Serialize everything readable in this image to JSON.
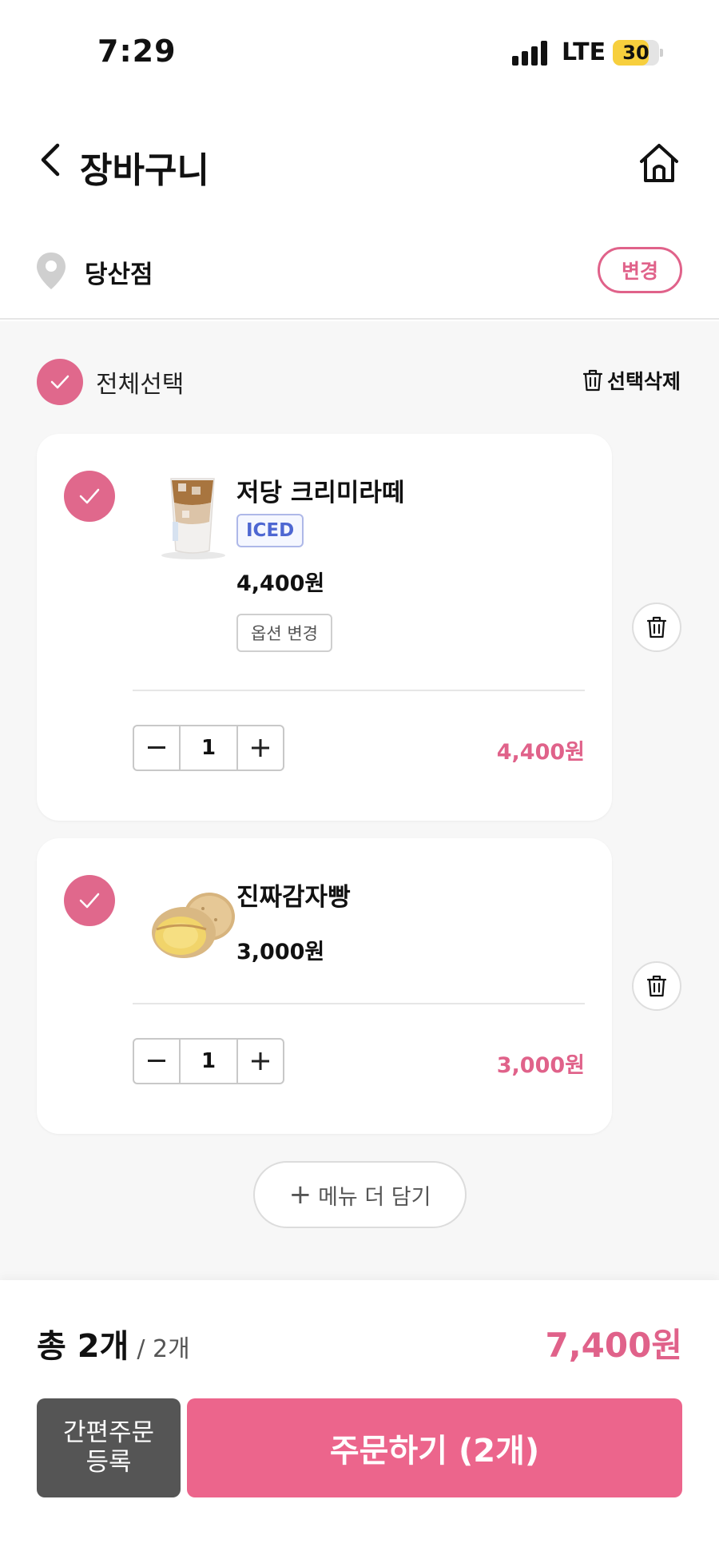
{
  "status": {
    "time": "7:29",
    "network": "LTE",
    "battery": "30",
    "battery_level": 0.3
  },
  "header": {
    "title": "장바구니",
    "back_icon": "chevron-left-icon",
    "home_icon": "home-icon"
  },
  "store": {
    "name": "당산점",
    "change_label": "변경",
    "icon": "location-pin-icon"
  },
  "selection": {
    "select_all_label": "전체선택",
    "delete_selected_label": "선택삭제"
  },
  "items": [
    {
      "name": "저당 크리미라떼",
      "tag": "ICED",
      "price": "4,400원",
      "option_label": "옵션 변경",
      "quantity": "1",
      "line_total": "4,400원"
    },
    {
      "name": "진짜감자빵",
      "price": "3,000원",
      "quantity": "1",
      "line_total": "3,000원"
    }
  ],
  "add_menu_label": "메뉴 더 담기",
  "footer": {
    "total_label": "총 2개",
    "total_of": "/ 2개",
    "total_price": "7,400원",
    "quick_order_line1": "간편주문",
    "quick_order_line2": "등록",
    "order_label": "주문하기 (2개)"
  },
  "colors": {
    "accent": "#e0628a",
    "order_button": "#ec658c",
    "quick_button": "#555555",
    "iced_tag": "#4e67d2",
    "battery": "#f7cf3d"
  }
}
